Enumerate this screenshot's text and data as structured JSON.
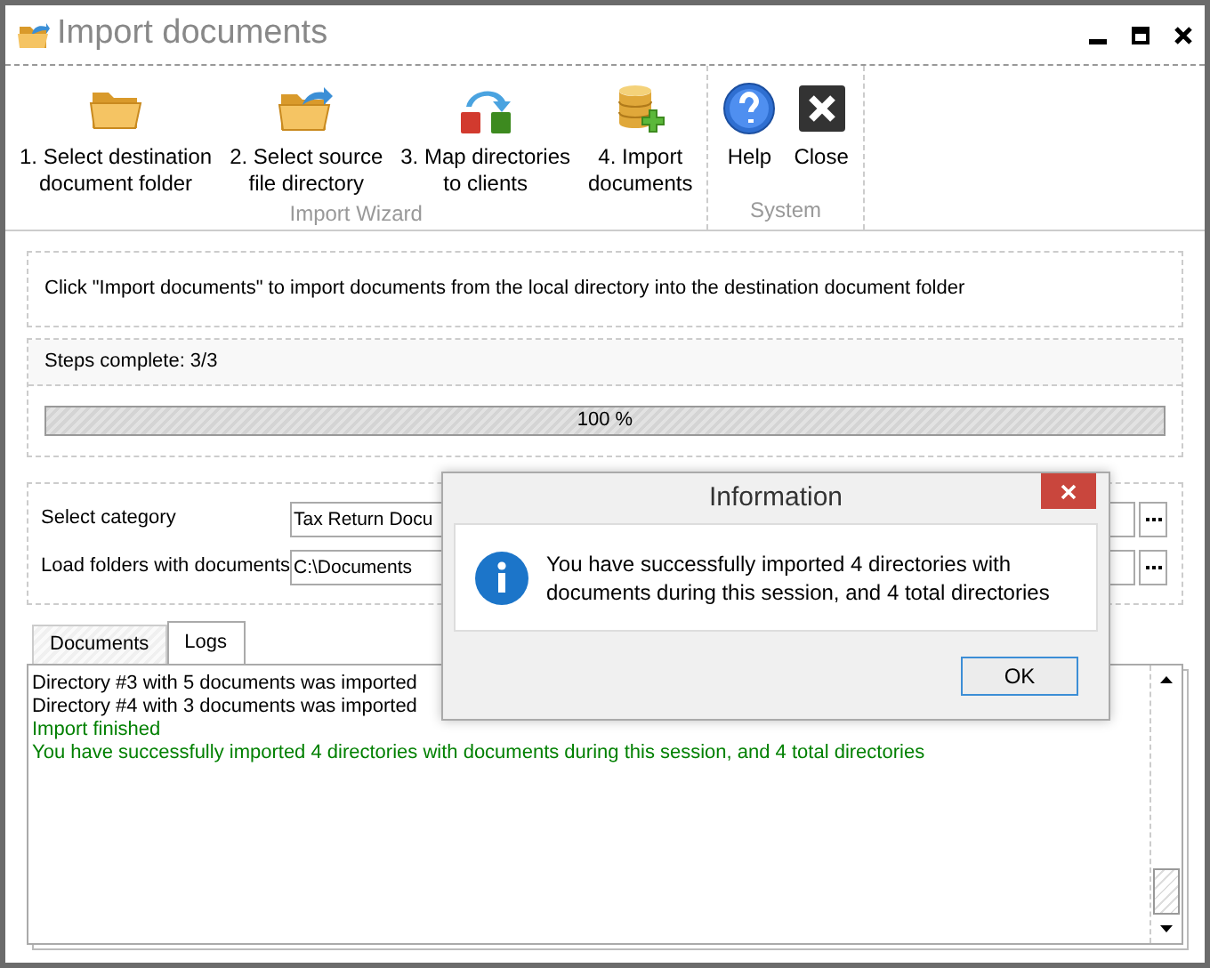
{
  "window": {
    "title": "Import documents"
  },
  "ribbon": {
    "groups": [
      {
        "label": "Import Wizard",
        "buttons": [
          {
            "kind": "folder",
            "lines": [
              "1. Select destination",
              "document folder"
            ]
          },
          {
            "kind": "folder-arrow",
            "lines": [
              "2. Select source",
              "file directory"
            ]
          },
          {
            "kind": "map",
            "lines": [
              "3. Map directories",
              "to clients"
            ]
          },
          {
            "kind": "database",
            "lines": [
              "4. Import",
              "documents"
            ]
          }
        ]
      },
      {
        "label": "System",
        "buttons": [
          {
            "kind": "help",
            "lines": [
              "Help"
            ]
          },
          {
            "kind": "close",
            "lines": [
              "Close"
            ]
          }
        ]
      }
    ]
  },
  "instruction": "Click \"Import documents\" to import documents from the local directory into the destination document folder",
  "progress": {
    "label": "Steps complete: 3/3",
    "level": 1,
    "reading": "100 %"
  },
  "fields": [
    {
      "label": "Select category",
      "value": "Tax Return Docu"
    },
    {
      "label": "Load folders with documents",
      "value": "C:\\Documents"
    }
  ],
  "tabs": [
    {
      "label": "Documents",
      "selected": false
    },
    {
      "label": "Logs",
      "selected": true
    }
  ],
  "log": [
    {
      "text": "Directory #3 with 5 documents was imported",
      "color": "#000000"
    },
    {
      "text": "Directory #4 with 3 documents was imported",
      "color": "#000000"
    },
    {
      "text": "Import finished",
      "color": "#008000"
    },
    {
      "text": "You have successfully imported 4 directories with documents during this session, and 4 total directories",
      "color": "#008000"
    }
  ],
  "dialog": {
    "title": "Information",
    "message": "You have successfully imported 4 directories with documents during this session, and 4 total directories",
    "button": "OK"
  }
}
